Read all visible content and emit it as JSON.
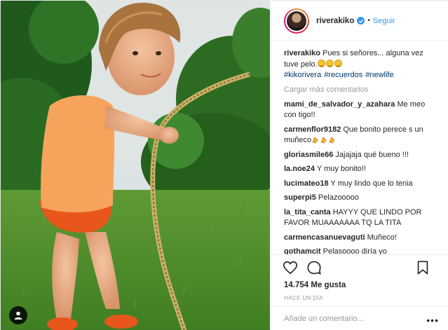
{
  "post": {
    "username": "riverakiko",
    "follow_label": "Seguir",
    "separator": "•",
    "caption": {
      "username": "riverakiko",
      "text": "Pues si señores... alguna vez tuve pelo.",
      "emojis": [
        "grimacing-emoji",
        "grimacing-emoji",
        "grimacing-emoji"
      ],
      "hashtags": [
        "#kikorivera",
        "#recuerdos",
        "#newlife"
      ]
    },
    "load_more_label": "Cargar más comentarios",
    "likes_label": "14.754 Me gusta",
    "time_label": "HACE UN DÍA",
    "comment_placeholder": "Añade un comentario...",
    "more_label": "•••"
  },
  "comments": [
    {
      "user": "mami_de_salvador_y_azahara",
      "text": "Me meo con tigo!!"
    },
    {
      "user": "carmenflor9182",
      "text": "Que bonito perece s un muñeco",
      "emojis": [
        "clapping-hands-emoji",
        "clapping-hands-emoji",
        "clapping-hands-emoji"
      ]
    },
    {
      "user": "gloriasmile66",
      "text": "Jajajaja qué bueno !!!"
    },
    {
      "user": "la.noe24",
      "text": "Y muy bonito!!"
    },
    {
      "user": "lucimateo18",
      "text": "Y muy lindo que lo tenia"
    },
    {
      "user": "superpi5",
      "text": "Pelazooooo"
    },
    {
      "user": "la_tita_canta",
      "text": "HAYYY QUE LINDO POR FAVOR MUAAAAAAA TQ LA TITA"
    },
    {
      "user": "carmencasanuevaguti",
      "text": "Muñeco!"
    },
    {
      "user": "gothamcit",
      "text": "Pelasoooo diría yo"
    }
  ],
  "icons": {
    "like": "heart-icon",
    "comment": "comment-bubble-icon",
    "save": "bookmark-icon",
    "user_tag": "user-tag-icon",
    "verified": "verified-badge-icon"
  },
  "colors": {
    "link_blue": "#3897f0",
    "hashtag": "#003569",
    "muted": "#999999",
    "text": "#262626"
  }
}
